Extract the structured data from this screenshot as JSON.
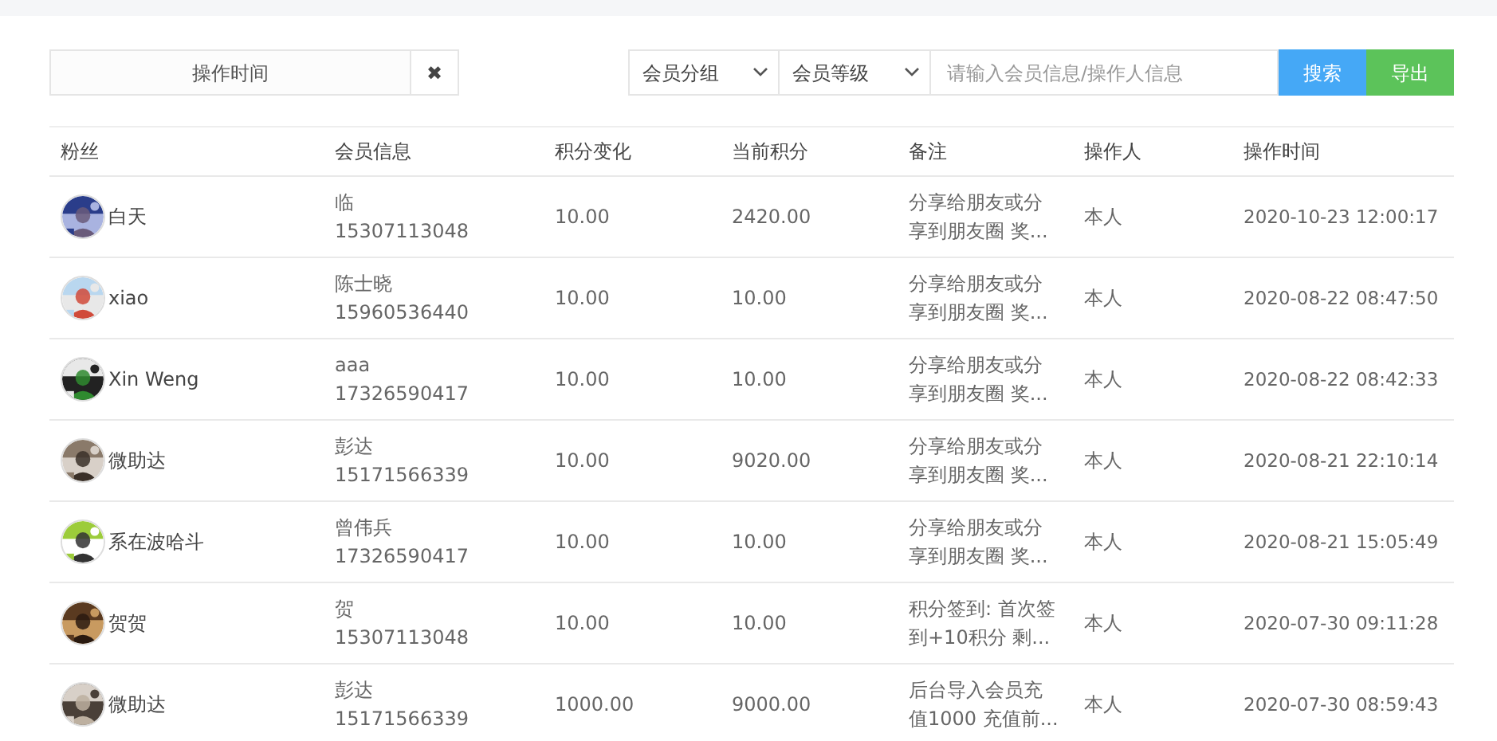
{
  "filters": {
    "date_field": {
      "placeholder": "操作时间"
    },
    "clear_button": "✖",
    "selects": [
      "会员分组",
      "会员等级"
    ],
    "search": {
      "placeholder": "请输入会员信息/操作人信息"
    },
    "buttons": [
      {
        "label": "搜索",
        "kind": "primary"
      },
      {
        "label": "导出",
        "kind": "success"
      }
    ]
  },
  "table": {
    "columns": [
      "粉丝",
      "会员信息",
      "积分变化",
      "当前积分",
      "备注",
      "操作人",
      "操作时间"
    ],
    "rows": [
      {
        "fan": {
          "name": "白天"
        },
        "member": [
          "临",
          "15307113048"
        ],
        "change": "10.00",
        "current": "2420.00",
        "remark": [
          "分享给朋友或分",
          "享到朋友圈 奖..."
        ],
        "operator": "本人",
        "time": "2020-10-23 12:00:17"
      },
      {
        "fan": {
          "name": "xiao"
        },
        "member": [
          "陈士晓",
          "15960536440"
        ],
        "change": "10.00",
        "current": "10.00",
        "remark": [
          "分享给朋友或分",
          "享到朋友圈 奖..."
        ],
        "operator": "本人",
        "time": "2020-08-22 08:47:50"
      },
      {
        "fan": {
          "name": "Xin Weng"
        },
        "member": [
          "aaa",
          "17326590417"
        ],
        "change": "10.00",
        "current": "10.00",
        "remark": [
          "分享给朋友或分",
          "享到朋友圈 奖..."
        ],
        "operator": "本人",
        "time": "2020-08-22 08:42:33"
      },
      {
        "fan": {
          "name": "微助达"
        },
        "member": [
          "彭达",
          "15171566339"
        ],
        "change": "10.00",
        "current": "9020.00",
        "remark": [
          "分享给朋友或分",
          "享到朋友圈 奖..."
        ],
        "operator": "本人",
        "time": "2020-08-21 22:10:14"
      },
      {
        "fan": {
          "name": "系在波哈斗"
        },
        "member": [
          "曾伟兵",
          "17326590417"
        ],
        "change": "10.00",
        "current": "10.00",
        "remark": [
          "分享给朋友或分",
          "享到朋友圈 奖..."
        ],
        "operator": "本人",
        "time": "2020-08-21 15:05:49"
      },
      {
        "fan": {
          "name": "贺贺"
        },
        "member": [
          "贺",
          "15307113048"
        ],
        "change": "10.00",
        "current": "10.00",
        "remark": [
          "积分签到: 首次签",
          "到+10积分 剩..."
        ],
        "operator": "本人",
        "time": "2020-07-30 09:11:28"
      },
      {
        "fan": {
          "name": "微助达"
        },
        "member": [
          "彭达",
          "15171566339"
        ],
        "change": "1000.00",
        "current": "9000.00",
        "remark": [
          "后台导入会员充",
          "值1000 充值前..."
        ],
        "operator": "本人",
        "time": "2020-07-30 08:59:43"
      }
    ]
  }
}
